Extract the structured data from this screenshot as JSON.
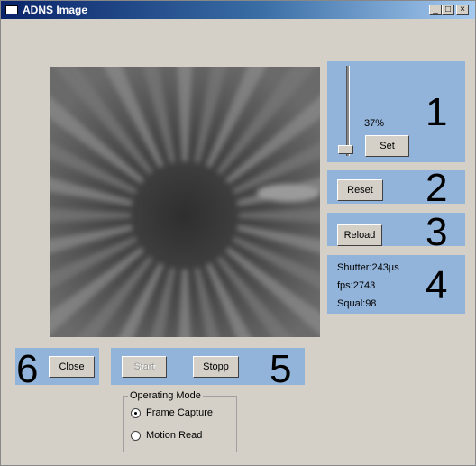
{
  "window": {
    "title": "ADNS Image",
    "minimize_symbol": "_",
    "maximize_symbol": "□",
    "close_symbol": "×"
  },
  "slider": {
    "value_label": "37%",
    "level": 0.37
  },
  "panels": {
    "p1": {
      "number": "1",
      "set_label": "Set"
    },
    "p2": {
      "number": "2",
      "reset_label": "Reset"
    },
    "p3": {
      "number": "3",
      "reload_label": "Reload"
    },
    "p4": {
      "number": "4",
      "shutter": "Shutter:243µs",
      "fps": "fps:2743",
      "squal": "Squal:98"
    },
    "p5": {
      "number": "5",
      "start_label": "Start",
      "stop_label": "Stopp"
    },
    "p6": {
      "number": "6",
      "close_label": "Close"
    }
  },
  "operating_mode": {
    "title": "Operating Mode",
    "options": [
      {
        "label": "Frame Capture",
        "selected": true
      },
      {
        "label": "Motion Read",
        "selected": false
      }
    ]
  },
  "colors": {
    "panel": "#93b4da",
    "window_bg": "#d4d0c8",
    "title_bar": "#0a246a"
  }
}
